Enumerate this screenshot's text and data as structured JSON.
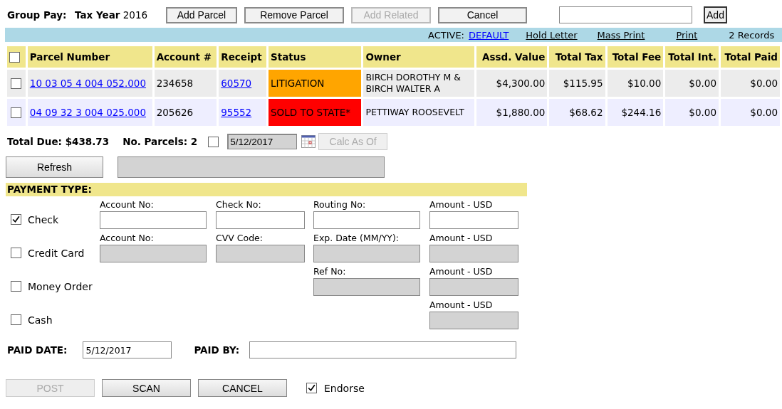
{
  "header": {
    "title": "Group Pay:",
    "tax_year_label": "Tax Year",
    "tax_year": "2016",
    "buttons": [
      {
        "label": "Add Parcel",
        "disabled": false
      },
      {
        "label": "Remove Parcel",
        "disabled": false
      },
      {
        "label": "Add Related",
        "disabled": true
      },
      {
        "label": "Cancel",
        "disabled": false
      }
    ],
    "add_button": "Add"
  },
  "toolbar": {
    "active_label": "ACTIVE:",
    "active_link": "DEFAULT",
    "links": [
      "Hold Letter",
      "Mass Print",
      "Print"
    ],
    "record_count": "2 Records"
  },
  "table": {
    "all_checked": false,
    "columns": [
      "Parcel Number",
      "Account #",
      "Receipt",
      "Status",
      "Owner",
      "Assd. Value",
      "Total Tax",
      "Total Fee",
      "Total Int.",
      "Total Paid"
    ],
    "rows": [
      {
        "checked": false,
        "parcel": "10 03 05 4 004 052.000",
        "account": "234658",
        "receipt": "60570",
        "status": "LITIGATION",
        "color": "#ffa500",
        "owner": "BIRCH DOROTHY M & BIRCH WALTER A",
        "assd_value": "$4,300.00",
        "total_tax": "$115.95",
        "total_fee": "$10.00",
        "total_int": "$0.00",
        "total_paid": "$0.00"
      },
      {
        "checked": false,
        "parcel": "04 09 32 3 004 025.000",
        "account": "205626",
        "receipt": "95552",
        "status": "SOLD TO STATE*",
        "color": "#ff0000",
        "owner": "PETTIWAY ROOSEVELT",
        "assd_value": "$1,880.00",
        "total_tax": "$68.62",
        "total_fee": "$244.16",
        "total_int": "$0.00",
        "total_paid": "$0.00"
      }
    ]
  },
  "summary": {
    "total_due": "Total Due: $438.73",
    "parcel_count": "No. Parcels: 2",
    "calc_checked": false,
    "calc_date": "5/12/2017",
    "calc_button": {
      "label": "Calc As Of",
      "disabled": true
    }
  },
  "refresh_button": "Refresh",
  "payment": {
    "title": "PAYMENT TYPE:",
    "methods": [
      {
        "label": "Check",
        "checked": true,
        "fields": [
          {
            "label": "Account No:",
            "disabled": false
          },
          {
            "label": "Check No:",
            "disabled": false
          },
          {
            "label": "Routing No:",
            "disabled": false
          },
          {
            "label": "Amount - USD",
            "disabled": false
          }
        ]
      },
      {
        "label": "Credit Card",
        "checked": false,
        "fields": [
          {
            "label": "Account No:",
            "disabled": true
          },
          {
            "label": "CVV Code:",
            "disabled": true
          },
          {
            "label": "Exp. Date (MM/YY):",
            "disabled": true
          },
          {
            "label": "Amount - USD",
            "disabled": true
          }
        ]
      },
      {
        "label": "Money Order",
        "checked": false,
        "fields": [
          {
            "label": "Ref No:",
            "disabled": true
          },
          {
            "label": "Amount - USD",
            "disabled": true
          }
        ]
      },
      {
        "label": "Cash",
        "checked": false,
        "fields": [
          {
            "label": "Amount - USD",
            "disabled": true
          }
        ]
      }
    ]
  },
  "paid_date": {
    "label": "PAID DATE:",
    "value": "5/12/2017"
  },
  "paid_by": {
    "label": "PAID BY:"
  },
  "actions": [
    {
      "label": "POST",
      "disabled": true
    },
    {
      "label": "SCAN",
      "disabled": false
    },
    {
      "label": "CANCEL",
      "disabled": false
    }
  ],
  "endorse": {
    "label": "Endorse",
    "checked": true
  }
}
